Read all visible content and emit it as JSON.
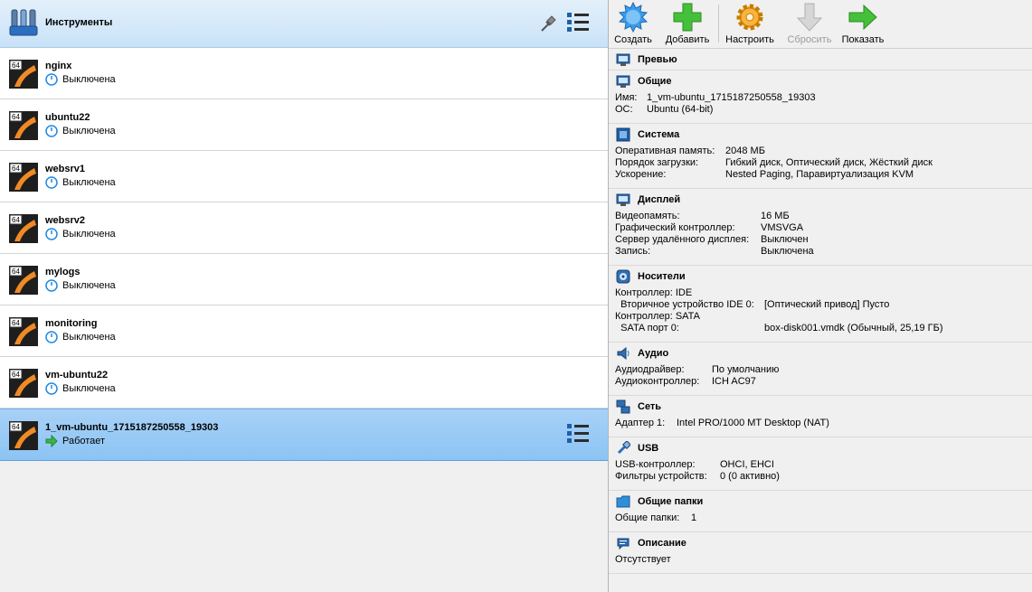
{
  "tools": {
    "title": "Инструменты"
  },
  "vms": [
    {
      "name": "nginx",
      "state": "Выключена",
      "status": "off"
    },
    {
      "name": "ubuntu22",
      "state": "Выключена",
      "status": "off"
    },
    {
      "name": "websrv1",
      "state": "Выключена",
      "status": "off"
    },
    {
      "name": "websrv2",
      "state": "Выключена",
      "status": "off"
    },
    {
      "name": "mylogs",
      "state": "Выключена",
      "status": "off"
    },
    {
      "name": "monitoring",
      "state": "Выключена",
      "status": "off"
    },
    {
      "name": "vm-ubuntu22",
      "state": "Выключена",
      "status": "off"
    },
    {
      "name": "1_vm-ubuntu_1715187250558_19303",
      "state": "Работает",
      "status": "running",
      "selected": true
    }
  ],
  "vm_badge": "64",
  "toolbar": {
    "create": "Создать",
    "add": "Добавить",
    "settings": "Настроить",
    "discard": "Сбросить",
    "show": "Показать"
  },
  "details": {
    "preview": {
      "title": "Превью"
    },
    "general": {
      "title": "Общие",
      "rows": [
        {
          "k": "Имя:",
          "v": "1_vm-ubuntu_1715187250558_19303"
        },
        {
          "k": "ОС:",
          "v": "Ubuntu (64-bit)"
        }
      ]
    },
    "system": {
      "title": "Система",
      "rows": [
        {
          "k": "Оперативная память:",
          "v": "2048 МБ"
        },
        {
          "k": "Порядок загрузки:",
          "v": "Гибкий диск, Оптический диск, Жёсткий диск"
        },
        {
          "k": "Ускорение:",
          "v": "Nested Paging, Паравиртуализация KVM"
        }
      ]
    },
    "display": {
      "title": "Дисплей",
      "rows": [
        {
          "k": "Видеопамять:",
          "v": "16 МБ"
        },
        {
          "k": "Графический контроллер:",
          "v": "VMSVGA"
        },
        {
          "k": "Сервер удалённого дисплея:",
          "v": "Выключен"
        },
        {
          "k": "Запись:",
          "v": "Выключена"
        }
      ]
    },
    "storage": {
      "title": "Носители",
      "rows": [
        {
          "k": "Контроллер: IDE",
          "v": ""
        },
        {
          "k": "  Вторичное устройство IDE 0:",
          "v": "[Оптический привод] Пусто"
        },
        {
          "k": "Контроллер: SATA",
          "v": ""
        },
        {
          "k": "  SATA порт 0:",
          "v": "box-disk001.vmdk (Обычный, 25,19 ГБ)"
        }
      ]
    },
    "audio": {
      "title": "Аудио",
      "rows": [
        {
          "k": "Аудиодрайвер:",
          "v": "По умолчанию"
        },
        {
          "k": "Аудиоконтроллер:",
          "v": "ICH AC97"
        }
      ]
    },
    "network": {
      "title": "Сеть",
      "rows": [
        {
          "k": "Адаптер 1:",
          "v": "Intel PRO/1000 MT Desktop (NAT)"
        }
      ]
    },
    "usb": {
      "title": "USB",
      "rows": [
        {
          "k": "USB-контроллер:",
          "v": "OHCI, EHCI"
        },
        {
          "k": "Фильтры устройств:",
          "v": "0 (0 активно)"
        }
      ]
    },
    "shared": {
      "title": "Общие папки",
      "rows": [
        {
          "k": "Общие папки:",
          "v": "1"
        }
      ]
    },
    "description": {
      "title": "Описание",
      "rows": [
        {
          "k": "Отсутствует",
          "v": ""
        }
      ]
    }
  },
  "colors": {
    "selection": "#8cc4f4",
    "header": "#c9e2f8",
    "running_arrow": "#3bb54a",
    "power_icon": "#1e88e5"
  }
}
